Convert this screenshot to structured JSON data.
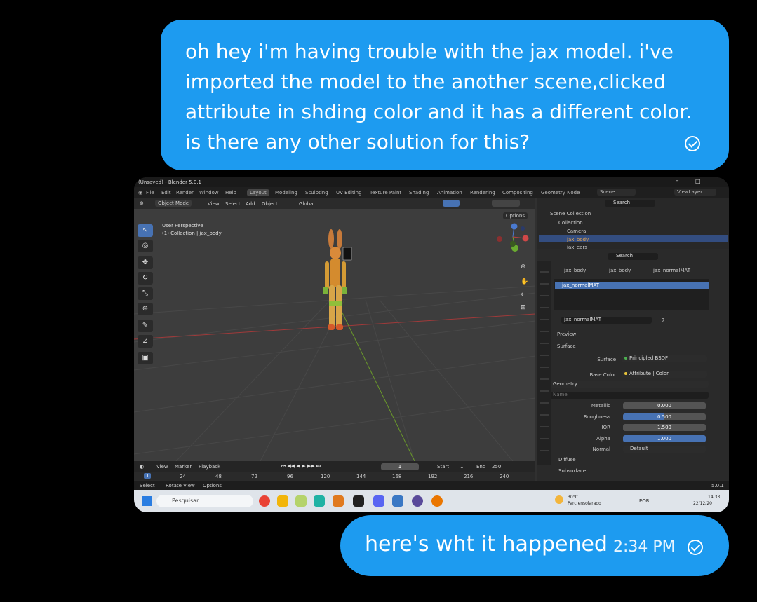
{
  "messages": {
    "first": {
      "text": "oh hey i'm having trouble with the jax model. i've imported the model to the another scene,clicked attribute in shding color and it has a different color. is there any other solution for this?"
    },
    "second": {
      "text": "here's wht it happened",
      "time": "2:34 PM"
    }
  },
  "blender": {
    "window_title": "(Unsaved) - Blender 5.0.1",
    "menu": [
      "File",
      "Edit",
      "Render",
      "Window",
      "Help"
    ],
    "workspaces": [
      "Layout",
      "Modeling",
      "Sculpting",
      "UV Editing",
      "Texture Paint",
      "Shading",
      "Animation",
      "Rendering",
      "Compositing",
      "Geometry Node"
    ],
    "scene": "Scene",
    "view_layer": "ViewLayer",
    "viewport_header": {
      "mode": "Object Mode",
      "menus": [
        "View",
        "Select",
        "Add",
        "Object"
      ],
      "orientation": "Global",
      "options": "Options"
    },
    "viewport_info": {
      "line1": "User Perspective",
      "line2": "(1) Collection | jax_body"
    },
    "timeline": {
      "menus": [
        "View",
        "Marker",
        "Playback"
      ],
      "current_frame": "1",
      "start_label": "Start",
      "start": "1",
      "end_label": "End",
      "end": "250",
      "ticks": [
        "1",
        "24",
        "48",
        "72",
        "96",
        "120",
        "144",
        "168",
        "192",
        "216",
        "240"
      ]
    },
    "status": {
      "select": "Select",
      "rotate": "Rotate View",
      "options": "Options",
      "version": "5.0.1"
    },
    "outliner": {
      "search": "Search",
      "items": [
        "Scene Collection",
        "Collection",
        "Camera",
        "jax_body",
        "jax_ears"
      ]
    },
    "properties": {
      "search": "Search",
      "breadcrumb": [
        "jax_body",
        "jax_body",
        "jax_normalMAT"
      ],
      "slot": "jax_normalMAT",
      "material_name": "jax_normalMAT",
      "users": "7",
      "preview": "Preview",
      "surface_panel": "Surface",
      "surface_label": "Surface",
      "surface_value": "Principled BSDF",
      "base_color_label": "Base Color",
      "base_color_value": "Attribute | Color",
      "geometry": "Geometry",
      "name_placeholder": "Name",
      "metallic_label": "Metallic",
      "metallic": "0.000",
      "roughness_label": "Roughness",
      "roughness": "0.500",
      "ior_label": "IOR",
      "ior": "1.500",
      "alpha_label": "Alpha",
      "alpha": "1.000",
      "normal_label": "Normal",
      "normal": "Default",
      "diffuse": "Diffuse",
      "subsurface": "Subsurface"
    }
  },
  "taskbar": {
    "search": "Pesquisar",
    "weather_temp": "30°C",
    "weather_desc": "Parc ensolarado",
    "lang": "POR",
    "time": "14:33",
    "date": "22/12/20"
  }
}
